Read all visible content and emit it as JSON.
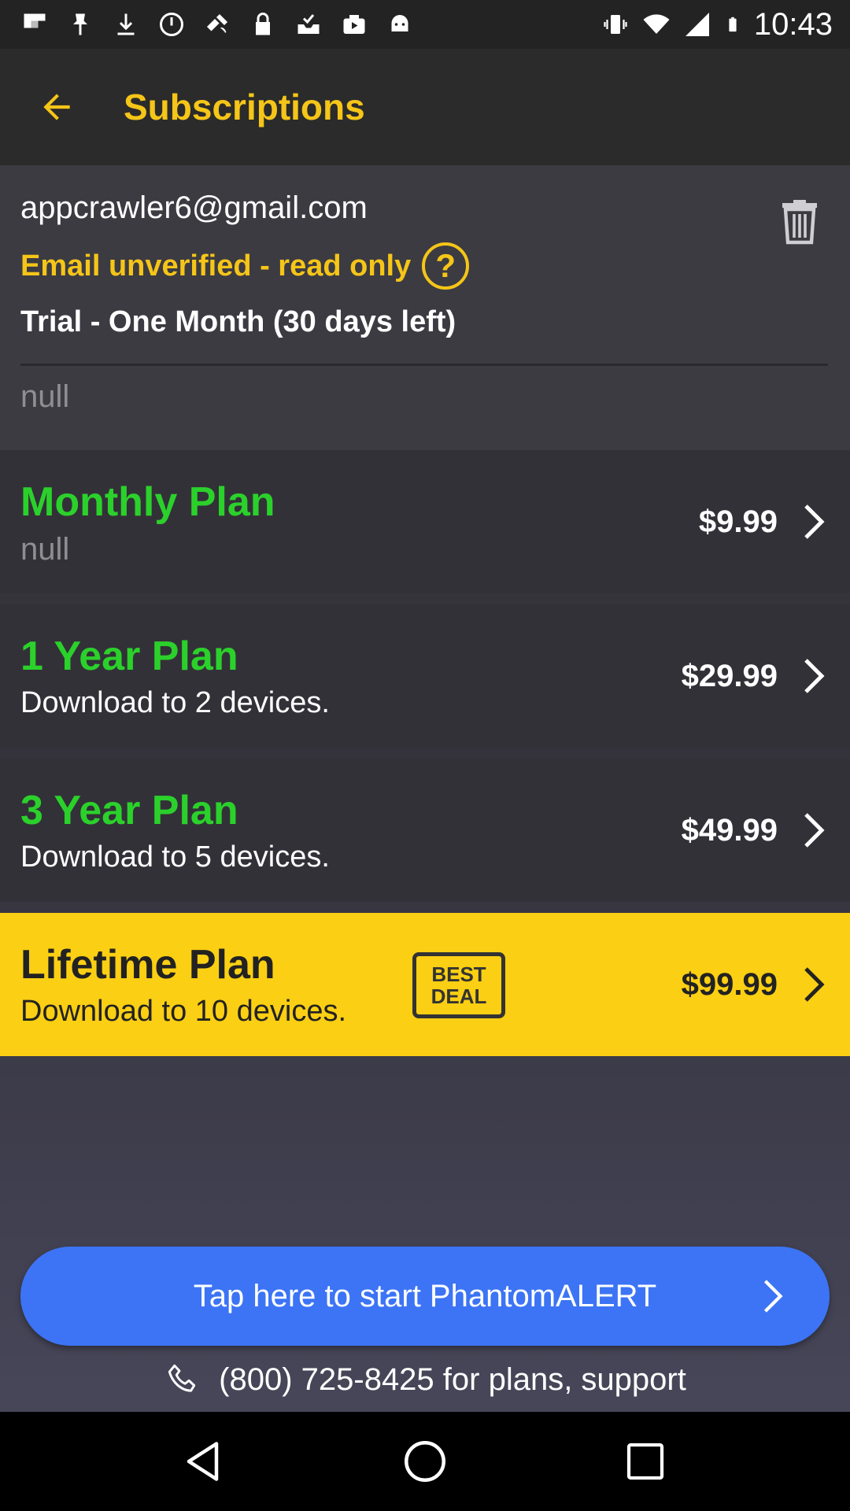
{
  "status_bar": {
    "time": "10:43",
    "left_icons": [
      "flipboard-icon",
      "sticky-pin-icon",
      "download-icon",
      "sync-icon",
      "satellite-icon",
      "lock-icon",
      "checkmark-inbox-icon",
      "youtube-icon",
      "android-icon"
    ],
    "right_icons": [
      "vibrate-icon",
      "wifi-icon",
      "signal-icon",
      "battery-icon"
    ]
  },
  "app_bar": {
    "title": "Subscriptions",
    "back_icon": "arrow-back-icon"
  },
  "account": {
    "email": "appcrawler6@gmail.com",
    "status": "Email unverified - read only",
    "help_symbol": "?",
    "trial": "Trial - One Month (30 days left)",
    "note": "null"
  },
  "plans": [
    {
      "name": "Monthly Plan",
      "description": "null",
      "price": "$9.99"
    },
    {
      "name": "1 Year Plan",
      "description": "Download to 2 devices.",
      "price": "$29.99"
    },
    {
      "name": "3 Year Plan",
      "description": "Download to 5 devices.",
      "price": "$49.99"
    },
    {
      "name": "Lifetime Plan",
      "description": "Download to 10 devices.",
      "price": "$99.99",
      "badge_line1": "BEST",
      "badge_line2": "DEAL"
    }
  ],
  "start_button": {
    "label": "Tap here to start PhantomALERT"
  },
  "support": {
    "text": "(800) 725-8425 for plans, support"
  },
  "colors": {
    "accent_yellow": "#f5c518",
    "plan_green": "#2bd12b",
    "button_blue": "#3c74f5",
    "highlight_yellow": "#fbcf13"
  }
}
